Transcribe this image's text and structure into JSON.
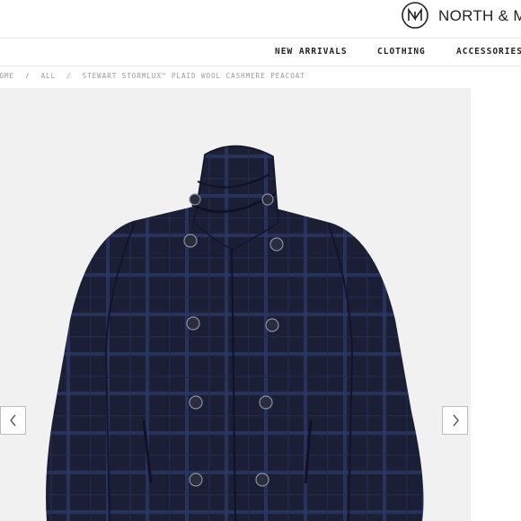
{
  "header": {
    "brand": "NORTH & MA",
    "logo_icon": "north-and-main-logo-icon"
  },
  "nav": {
    "items": [
      {
        "label": "NEW ARRIVALS"
      },
      {
        "label": "CLOTHING"
      },
      {
        "label": "ACCESSORIES"
      }
    ]
  },
  "breadcrumb": {
    "home": "HOME",
    "separator": "/",
    "all": "ALL",
    "product": "STEWART STORMLUX™ PLAID WOOL CASHMERE PEACOAT"
  },
  "gallery": {
    "image_icon": "peacoat-image",
    "prev_icon": "chevron-left-icon",
    "next_icon": "chevron-right-icon"
  },
  "colors": {
    "coat": "#1b1f36",
    "plaid": "#2c3a6a",
    "background": "#f1f1f1"
  }
}
